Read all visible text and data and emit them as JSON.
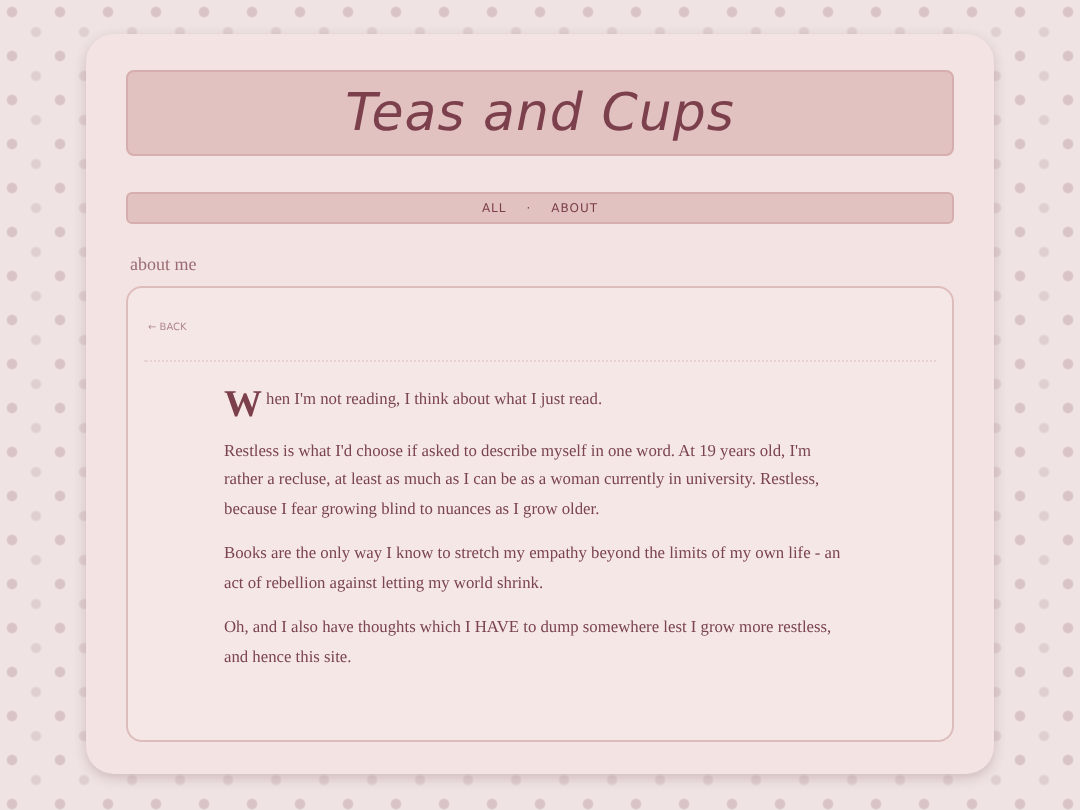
{
  "site_title": "Teas and Cups",
  "nav": {
    "items": [
      {
        "label": "ALL"
      },
      {
        "label": "ABOUT"
      }
    ],
    "separator": "·"
  },
  "section_label": "about me",
  "content": {
    "back_link": "← BACK",
    "paragraphs": [
      {
        "kind": "dropcap",
        "text": "When I'm not reading, I think about what I just read."
      },
      {
        "kind": "plain",
        "text": "Restless is what I'd choose if asked to describe myself in one word. At 19 years old, I'm rather a recluse, at least as much as I can be as a woman currently in university. Restless, because I fear growing blind to nuances as I grow older."
      },
      {
        "kind": "plain",
        "text": "Books are the only way I know to stretch my empathy beyond the limits of my own life - an act of rebellion against letting my world shrink."
      },
      {
        "kind": "plain",
        "text": "Oh, and I also have thoughts which I HAVE to dump somewhere lest I grow more restless, and hence this site."
      }
    ]
  }
}
